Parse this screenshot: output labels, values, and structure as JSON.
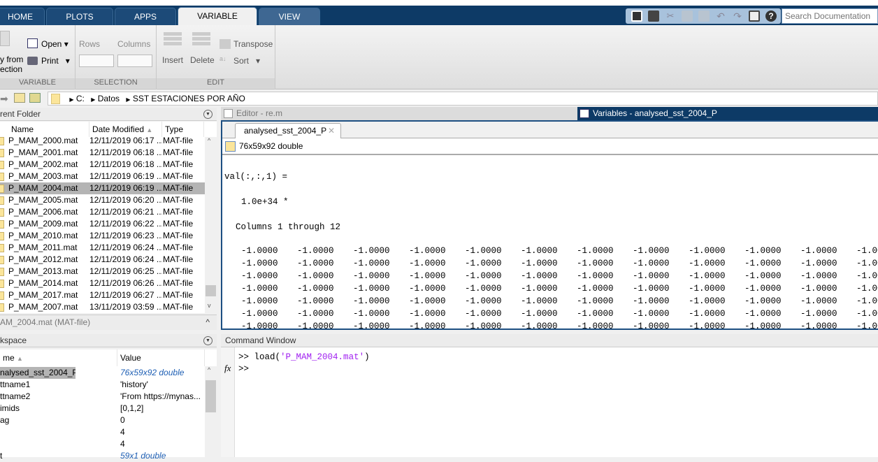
{
  "ribbon_tabs": [
    "HOME",
    "PLOTS",
    "APPS",
    "VARIABLE",
    "VIEW"
  ],
  "active_tab": "VARIABLE",
  "search_placeholder": "Search Documentation",
  "quick_access_icons": [
    "new-simulink-icon",
    "save-icon",
    "cut-icon",
    "copy-icon",
    "paste-icon",
    "undo-icon",
    "redo-icon",
    "switch-windows-icon",
    "help-icon"
  ],
  "ribbon": {
    "variable": {
      "new_from_selection_line1": "y from",
      "new_from_selection_line2": "ection",
      "open": "Open",
      "print": "Print",
      "label": "VARIABLE"
    },
    "selection": {
      "rows": "Rows",
      "columns": "Columns",
      "label": "SELECTION"
    },
    "edit": {
      "insert": "Insert",
      "delete": "Delete",
      "transpose": "Transpose",
      "sort": "Sort",
      "label": "EDIT"
    }
  },
  "address": {
    "path": [
      "C:",
      "Datos",
      "SST ESTACIONES POR AÑO"
    ]
  },
  "current_folder": {
    "title": "rent Folder",
    "columns": [
      "Name",
      "Date Modified",
      "Type"
    ],
    "rows": [
      [
        "P_MAM_2000.mat",
        "12/11/2019 06:17 ...",
        "MAT-file"
      ],
      [
        "P_MAM_2001.mat",
        "12/11/2019 06:18 ...",
        "MAT-file"
      ],
      [
        "P_MAM_2002.mat",
        "12/11/2019 06:18 ...",
        "MAT-file"
      ],
      [
        "P_MAM_2003.mat",
        "12/11/2019 06:19 ...",
        "MAT-file"
      ],
      [
        "P_MAM_2004.mat",
        "12/11/2019 06:19 ...",
        "MAT-file"
      ],
      [
        "P_MAM_2005.mat",
        "12/11/2019 06:20 ...",
        "MAT-file"
      ],
      [
        "P_MAM_2006.mat",
        "12/11/2019 06:21 ...",
        "MAT-file"
      ],
      [
        "P_MAM_2009.mat",
        "12/11/2019 06:22 ...",
        "MAT-file"
      ],
      [
        "P_MAM_2010.mat",
        "12/11/2019 06:23 ...",
        "MAT-file"
      ],
      [
        "P_MAM_2011.mat",
        "12/11/2019 06:24 ...",
        "MAT-file"
      ],
      [
        "P_MAM_2012.mat",
        "12/11/2019 06:24 ...",
        "MAT-file"
      ],
      [
        "P_MAM_2013.mat",
        "12/11/2019 06:25 ...",
        "MAT-file"
      ],
      [
        "P_MAM_2014.mat",
        "12/11/2019 06:26 ...",
        "MAT-file"
      ],
      [
        "P_MAM_2017.mat",
        "12/11/2019 06:27 ...",
        "MAT-file"
      ],
      [
        "P_MAM_2007.mat",
        "13/11/2019 03:59 ...",
        "MAT-file"
      ]
    ],
    "selected_index": 4,
    "details": "AM_2004.mat (MAT-file)"
  },
  "workspace": {
    "title": "kspace",
    "columns": [
      "me",
      "Value"
    ],
    "rows": [
      [
        "nalysed_sst_2004_P",
        "76x59x92 double",
        true
      ],
      [
        "ttname1",
        "'history'",
        false
      ],
      [
        "ttname2",
        "'From https://mynas...",
        false
      ],
      [
        "imids",
        "[0,1,2]",
        false
      ],
      [
        "ag",
        "0",
        false
      ],
      [
        "",
        "4",
        false
      ],
      [
        "",
        "4",
        false
      ],
      [
        "t",
        "59x1 double",
        true
      ]
    ]
  },
  "editor_tabs": {
    "editor": "Editor - re.m",
    "variables": "Variables - analysed_sst_2004_P"
  },
  "variable_editor": {
    "doc_tab": "analysed_sst_2004_P",
    "info": "76x59x92 double",
    "output_header": "val(:,:,1) =",
    "scale": "1.0e+34 *",
    "columns_label": "Columns 1 through 12",
    "cell_value": "-1.0000",
    "row_count": 7,
    "col_count": 12
  },
  "command_window": {
    "title": "Command Window",
    "prompt": ">>",
    "command": "load(",
    "command_arg": "'P_MAM_2004.mat'",
    "command_end": ")"
  }
}
